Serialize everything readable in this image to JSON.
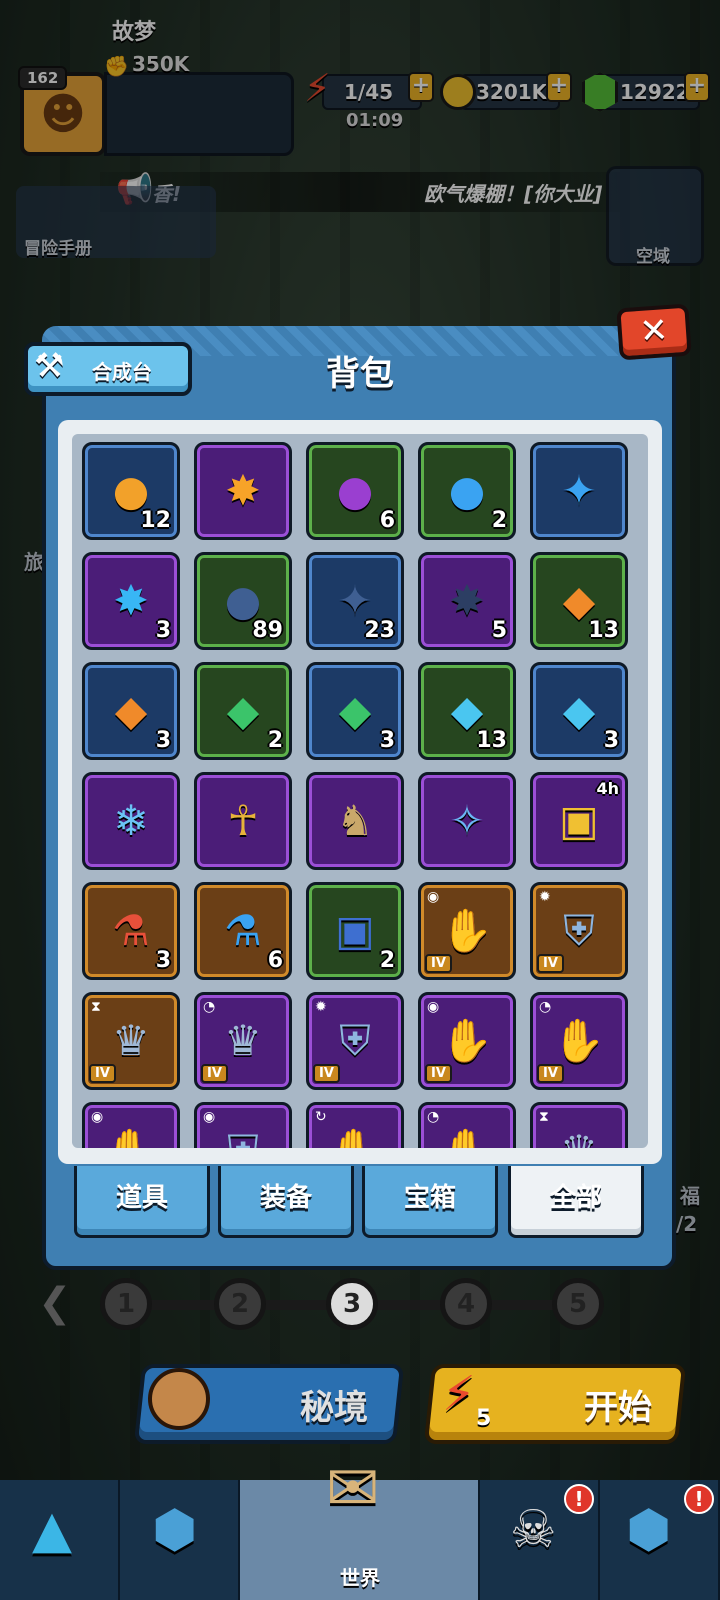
{
  "player": {
    "level": "162",
    "name": "故梦",
    "power": "350K"
  },
  "resources": {
    "energy": "1/45",
    "timer": "01:09",
    "coins": "3201K",
    "gems": "12922",
    "plus": "+"
  },
  "announcement": {
    "left_text": "香!",
    "right_text": "欧气爆棚！[你大业]"
  },
  "side": {
    "handbook_label": "冒险手册",
    "kongyu_label": "空域",
    "left_partial": "旅",
    "right_partial_top": "福",
    "right_partial_bottom": "/2"
  },
  "modal": {
    "title": "背包",
    "craft_label": "合成台",
    "close_label": "✕"
  },
  "items": [
    {
      "icon": "●",
      "color": "#f2a12a",
      "bg": "#1c3a66",
      "rim": "#4f86cc",
      "count": "12"
    },
    {
      "icon": "✸",
      "color": "#f7a328",
      "bg": "#4b1d78",
      "rim": "#9b4fd6",
      "count": ""
    },
    {
      "icon": "●",
      "color": "#9a3fd0",
      "bg": "#26461f",
      "rim": "#5db04a",
      "count": "6"
    },
    {
      "icon": "●",
      "color": "#3aa3f2",
      "bg": "#26461f",
      "rim": "#5db04a",
      "count": "2"
    },
    {
      "icon": "✦",
      "color": "#3aa3f2",
      "bg": "#1c3a66",
      "rim": "#4f86cc",
      "count": ""
    },
    {
      "icon": "✸",
      "color": "#38b6f5",
      "bg": "#4b1d78",
      "rim": "#9b4fd6",
      "count": "3"
    },
    {
      "icon": "●",
      "color": "#3f5f92",
      "bg": "#26461f",
      "rim": "#5db04a",
      "count": "89"
    },
    {
      "icon": "✦",
      "color": "#3f5f92",
      "bg": "#1c3a66",
      "rim": "#4f86cc",
      "count": "23"
    },
    {
      "icon": "✸",
      "color": "#2c3e63",
      "bg": "#4b1d78",
      "rim": "#9b4fd6",
      "count": "5"
    },
    {
      "icon": "◆",
      "color": "#f08a2a",
      "bg": "#26461f",
      "rim": "#5db04a",
      "count": "13"
    },
    {
      "icon": "◆",
      "color": "#f08a2a",
      "bg": "#1c3a66",
      "rim": "#4f86cc",
      "count": "3"
    },
    {
      "icon": "◆",
      "color": "#3bc46a",
      "bg": "#26461f",
      "rim": "#5db04a",
      "count": "2"
    },
    {
      "icon": "◆",
      "color": "#3bc46a",
      "bg": "#1c3a66",
      "rim": "#4f86cc",
      "count": "3"
    },
    {
      "icon": "◆",
      "color": "#4ac6f0",
      "bg": "#26461f",
      "rim": "#5db04a",
      "count": "13"
    },
    {
      "icon": "◆",
      "color": "#4ac6f0",
      "bg": "#1c3a66",
      "rim": "#4f86cc",
      "count": "3"
    },
    {
      "icon": "❄",
      "color": "#6bc3f5",
      "bg": "#4b1d78",
      "rim": "#9b4fd6",
      "count": ""
    },
    {
      "icon": "☥",
      "color": "#e8b33a",
      "bg": "#4b1d78",
      "rim": "#9b4fd6",
      "count": ""
    },
    {
      "icon": "♞",
      "color": "#c9a86a",
      "bg": "#4b1d78",
      "rim": "#9b4fd6",
      "count": ""
    },
    {
      "icon": "✧",
      "color": "#6bb6f5",
      "bg": "#4b1d78",
      "rim": "#9b4fd6",
      "count": ""
    },
    {
      "icon": "▣",
      "color": "#f0c032",
      "bg": "#4b1d78",
      "rim": "#9b4fd6",
      "count": "",
      "timer": "4h"
    },
    {
      "icon": "⚗",
      "color": "#e8503a",
      "bg": "#6b3f16",
      "rim": "#d08a2a",
      "count": "3"
    },
    {
      "icon": "⚗",
      "color": "#3aa3f2",
      "bg": "#6b3f16",
      "rim": "#d08a2a",
      "count": "6"
    },
    {
      "icon": "▣",
      "color": "#3e6fd0",
      "bg": "#26461f",
      "rim": "#5db04a",
      "count": "2"
    },
    {
      "icon": "✋",
      "color": "#8fb6df",
      "bg": "#6b3f16",
      "rim": "#d08a2a",
      "count": "",
      "tier": "IV",
      "tag": "◉"
    },
    {
      "icon": "⛨",
      "color": "#8fb6df",
      "bg": "#6b3f16",
      "rim": "#d08a2a",
      "count": "",
      "tier": "IV",
      "tag": "✹"
    },
    {
      "icon": "♛",
      "color": "#9fb8d6",
      "bg": "#6b3f16",
      "rim": "#d08a2a",
      "count": "",
      "tier": "IV",
      "tag": "⧗"
    },
    {
      "icon": "♛",
      "color": "#9fb8d6",
      "bg": "#4b1d78",
      "rim": "#9b4fd6",
      "count": "",
      "tier": "IV",
      "tag": "◔"
    },
    {
      "icon": "⛨",
      "color": "#8fb6df",
      "bg": "#4b1d78",
      "rim": "#9b4fd6",
      "count": "",
      "tier": "IV",
      "tag": "✹"
    },
    {
      "icon": "✋",
      "color": "#8fb6df",
      "bg": "#4b1d78",
      "rim": "#9b4fd6",
      "count": "",
      "tier": "IV",
      "tag": "◉"
    },
    {
      "icon": "✋",
      "color": "#8fb6df",
      "bg": "#4b1d78",
      "rim": "#9b4fd6",
      "count": "",
      "tier": "IV",
      "tag": "◔"
    },
    {
      "icon": "✋",
      "color": "#8fb6df",
      "bg": "#4b1d78",
      "rim": "#9b4fd6",
      "count": "",
      "tag": "◉"
    },
    {
      "icon": "⛨",
      "color": "#8fb6df",
      "bg": "#4b1d78",
      "rim": "#9b4fd6",
      "count": "",
      "tag": "◉"
    },
    {
      "icon": "✋",
      "color": "#8fb6df",
      "bg": "#4b1d78",
      "rim": "#9b4fd6",
      "count": "",
      "tag": "↻"
    },
    {
      "icon": "✋",
      "color": "#8fb6df",
      "bg": "#4b1d78",
      "rim": "#9b4fd6",
      "count": "",
      "tag": "◔"
    },
    {
      "icon": "♛",
      "color": "#9fb8d6",
      "bg": "#4b1d78",
      "rim": "#9b4fd6",
      "count": "",
      "tag": "⧗"
    }
  ],
  "tabs": [
    {
      "label": "道具",
      "active": false
    },
    {
      "label": "装备",
      "active": false
    },
    {
      "label": "宝箱",
      "active": false
    },
    {
      "label": "全部",
      "active": true
    }
  ],
  "stages": [
    "1",
    "2",
    "3",
    "4",
    "5"
  ],
  "current_stage": "3",
  "actions": {
    "mijing_label": "秘境",
    "start_label": "开始",
    "start_cost": "5"
  },
  "nav": {
    "world_label": "世界",
    "alert": "!"
  }
}
